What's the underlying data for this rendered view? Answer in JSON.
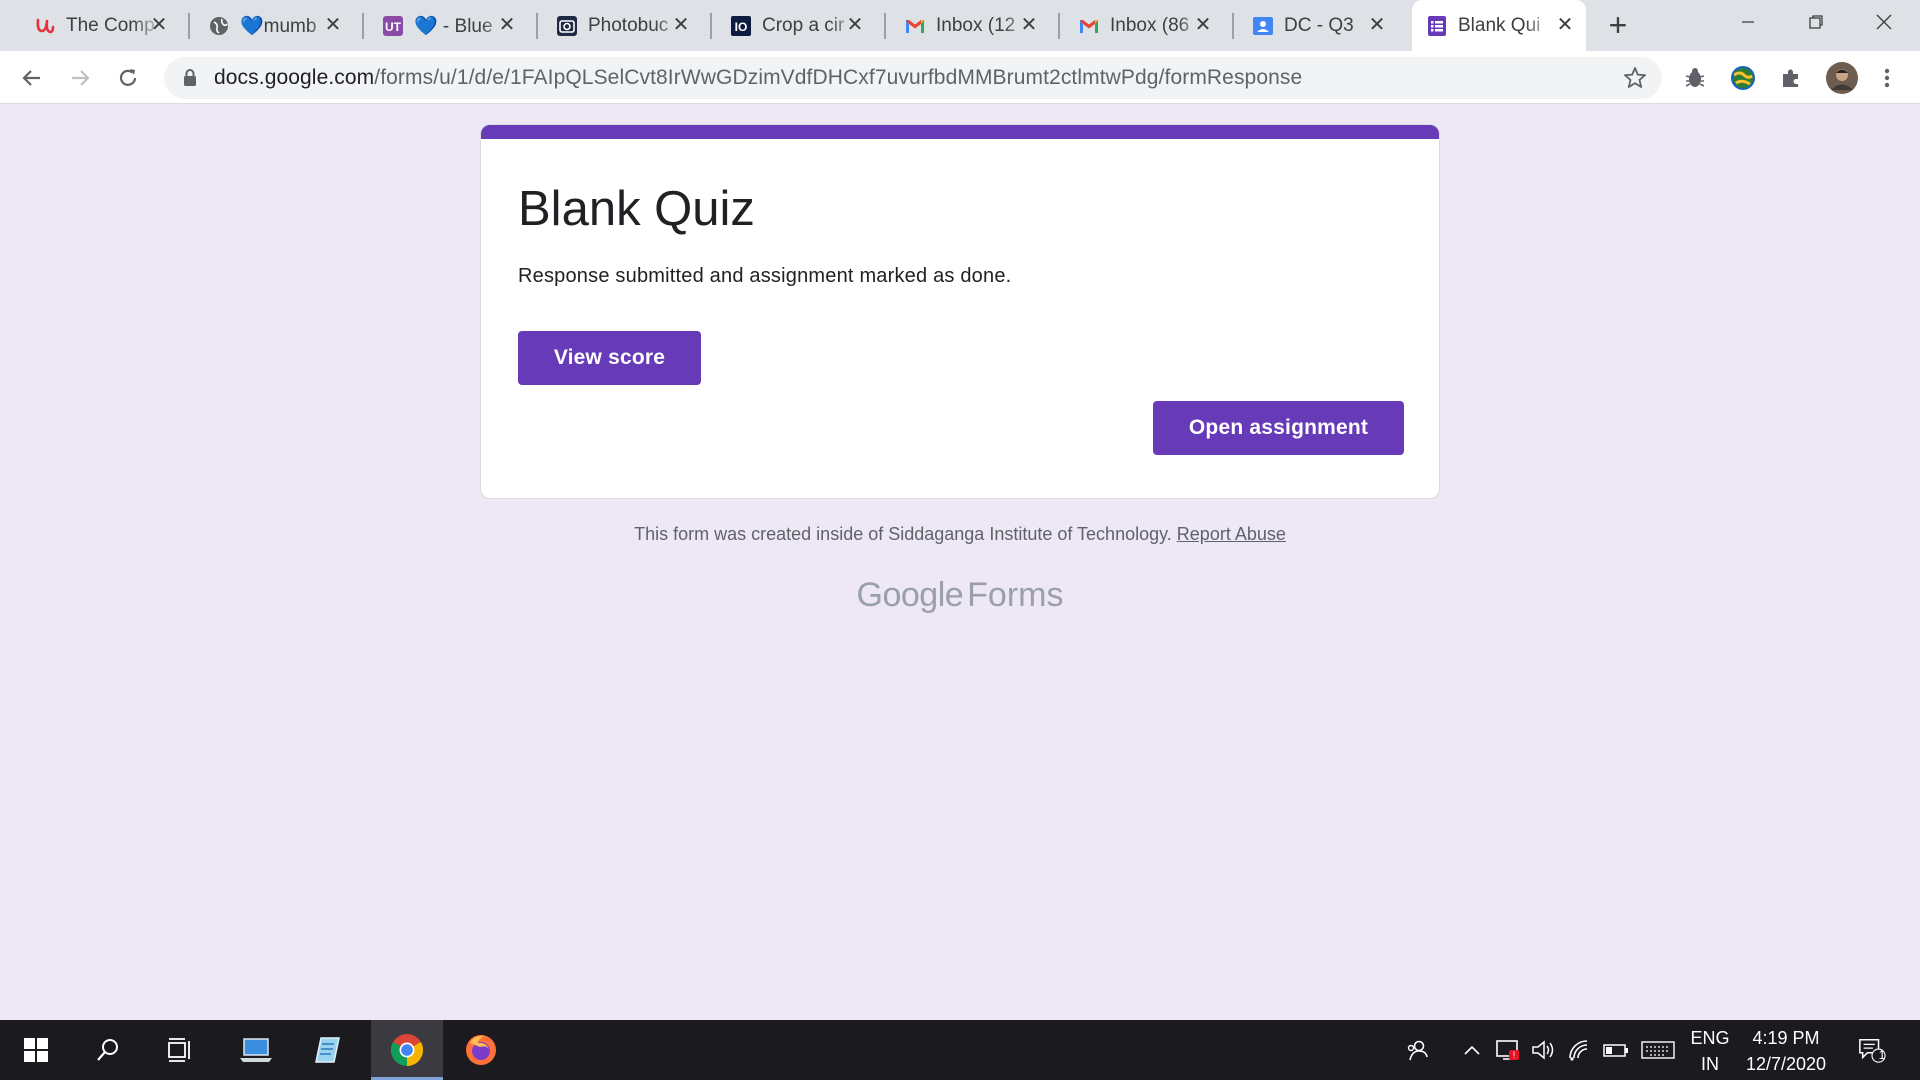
{
  "browser": {
    "tabs": [
      {
        "title": "The Comp",
        "icon": "u-logo-icon"
      },
      {
        "title": "💙mumb",
        "icon": "globe-icon"
      },
      {
        "title": "💙 - Blue",
        "icon": "ut-logo-icon"
      },
      {
        "title": "Photobuc",
        "icon": "camera-icon"
      },
      {
        "title": "Crop a cir",
        "icon": "io-logo-icon"
      },
      {
        "title": "Inbox (12",
        "icon": "gmail-icon"
      },
      {
        "title": "Inbox (86",
        "icon": "gmail-icon"
      },
      {
        "title": "DC - Q3",
        "icon": "classroom-icon"
      },
      {
        "title": "Blank Qui",
        "icon": "forms-icon",
        "active": true
      }
    ],
    "url_host": "docs.google.com",
    "url_path": "/forms/u/1/d/e/1FAIpQLSelCvt8IrWwGDzimVdfDHCxf7uvurfbdMMBrumt2ctlmtwPdg/formResponse"
  },
  "form": {
    "title": "Blank Quiz",
    "message": "Response submitted and assignment marked as done.",
    "view_score_label": "View score",
    "open_assignment_label": "Open assignment",
    "footer_text": "This form was created inside of Siddaganga Institute of Technology.",
    "report_abuse_label": "Report Abuse",
    "logo_google": "Google",
    "logo_forms": "Forms"
  },
  "taskbar": {
    "language_top": "ENG",
    "language_bottom": "IN",
    "time": "4:19 PM",
    "date": "12/7/2020",
    "notification_count": "1"
  },
  "colors": {
    "accent": "#673ab7",
    "page_bg": "#ede7f6"
  }
}
